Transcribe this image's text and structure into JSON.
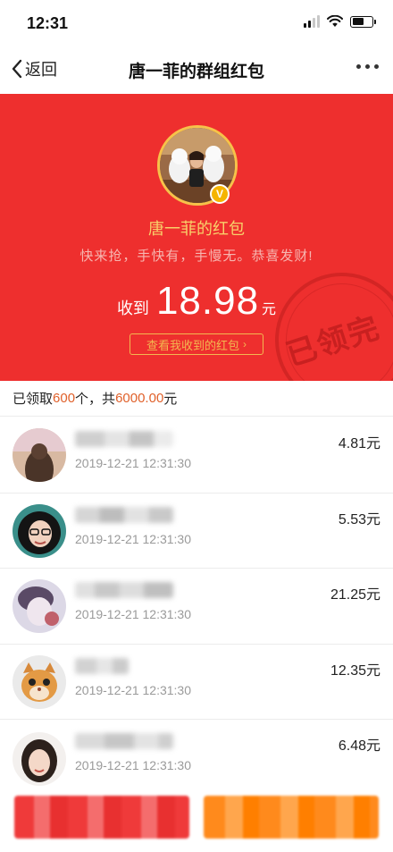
{
  "status": {
    "time": "12:31"
  },
  "nav": {
    "back_label": "返回",
    "title": "唐一菲的群组红包"
  },
  "header": {
    "sender_name": "唐一菲的红包",
    "greeting": "快来抢，手快有，手慢无。恭喜发财!",
    "amount_prefix": "收到",
    "amount": "18.98",
    "amount_unit": "元",
    "view_link": "查看我收到的红包",
    "stamp_text": "已领完",
    "vip_badge": "V",
    "colors": {
      "background": "#ee2f2e",
      "gold": "#f8d06a"
    }
  },
  "summary": {
    "prefix": "已领取",
    "count": "600",
    "mid": "个，共",
    "total": "6000.00",
    "suffix": "元"
  },
  "records": [
    {
      "time": "2019-12-21 12:31:30",
      "amount": "4.81元"
    },
    {
      "time": "2019-12-21 12:31:30",
      "amount": "5.53元"
    },
    {
      "time": "2019-12-21 12:31:30",
      "amount": "21.25元"
    },
    {
      "time": "2019-12-21 12:31:30",
      "amount": "12.35元"
    },
    {
      "time": "2019-12-21 12:31:30",
      "amount": "6.48元"
    }
  ],
  "bottom": {
    "left_button": "",
    "right_button": ""
  }
}
